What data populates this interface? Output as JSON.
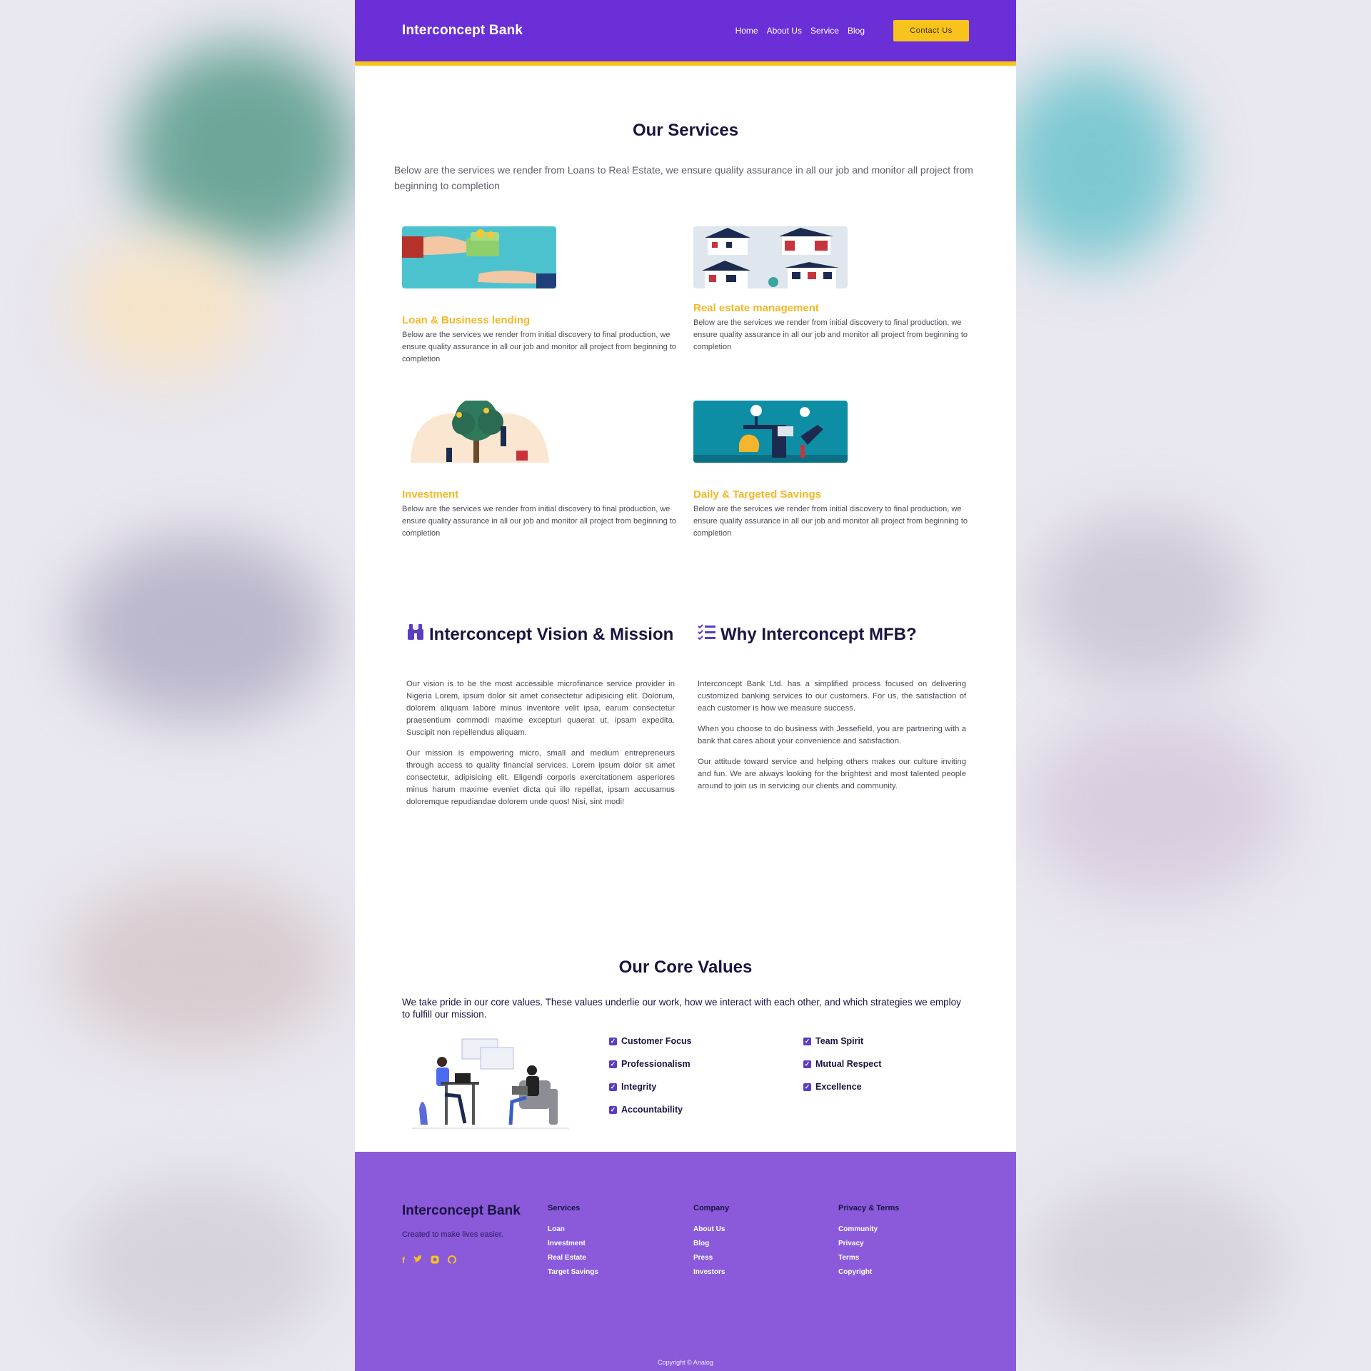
{
  "colors": {
    "brand_purple": "#6a2fd7",
    "accent_yellow": "#f7c31c",
    "footer_purple": "#8a5adb",
    "title_navy": "#1a1440"
  },
  "header": {
    "brand": "Interconcept Bank",
    "nav": [
      "Home",
      "About Us",
      "Service",
      "Blog"
    ],
    "contact_label": "Contact Us"
  },
  "services": {
    "title": "Our Services",
    "intro": "Below are the services we render from Loans to Real Estate, we ensure quality assurance in all our job and monitor all project from beginning to completion",
    "items": [
      {
        "title": "Loan & Business lending",
        "text": "Below are the services we render from initial discovery to final production, we ensure quality assurance in all our job and monitor all project from beginning to completion"
      },
      {
        "title": "Real estate management",
        "text": "Below are the services we render from initial discovery to final production, we ensure quality assurance in all our job and monitor all project from beginning to completion"
      },
      {
        "title": "Investment",
        "text": "Below are the services we render from initial discovery to final production, we ensure quality assurance in all our job and monitor all project from beginning to completion"
      },
      {
        "title": "Daily & Targeted Savings",
        "text": "Below are the services we render from initial discovery to final production, we ensure quality assurance in all our job and monitor all project from beginning to completion"
      }
    ]
  },
  "vision": {
    "title": "Interconcept Vision & Mission",
    "icon": "binoculars-icon",
    "paragraphs": [
      "Our vision is to be the most accessible microfinance service provider in Nigeria Lorem, ipsum dolor sit amet consectetur adipisicing elit. Dolorum, dolorem aliquam labore minus inventore velit ipsa, earum consectetur praesentium commodi maxime excepturi quaerat ut, ipsam expedita. Suscipit non repellendus aliquam.",
      "Our mission is empowering micro, small and medium entrepreneurs through access to quality financial services. Lorem ipsum dolor sit amet consectetur, adipisicing elit. Eligendi corporis exercitationem asperiores minus harum maxime eveniet dicta qui illo repellat, ipsam accusamus doloremque repudiandae dolorem unde quos! Nisi, sint modi!"
    ]
  },
  "why": {
    "title": "Why Interconcept MFB?",
    "icon": "checklist-icon",
    "paragraphs": [
      "Interconcept Bank Ltd. has a simplified process focused on delivering customized banking services to our customers. For us, the satisfaction of each customer is how we measure success.",
      "When you choose to do business with Jessefield, you are partnering with a bank that cares about your convenience and satisfaction.",
      "Our attitude toward service and helping others makes our culture inviting and fun. We are always looking for the brightest and most talented people around to join us in servicing our clients and community."
    ]
  },
  "core_values": {
    "title": "Our Core Values",
    "intro": "We take pride in our core values. These values underlie our work, how we interact with each other, and which strategies we employ to fulfill our mission.",
    "left": [
      "Customer Focus",
      "Professionalism",
      "Integrity",
      "Accountability"
    ],
    "right": [
      "Team Spirit",
      "Mutual Respect",
      "Excellence"
    ]
  },
  "footer": {
    "brand": "Interconcept Bank",
    "tagline": "Created to make lives easier.",
    "social": [
      "facebook-icon",
      "twitter-icon",
      "instagram-icon",
      "github-icon"
    ],
    "columns": [
      {
        "heading": "Services",
        "links": [
          "Loan",
          "Investment",
          "Real Estate",
          "Target Savings"
        ]
      },
      {
        "heading": "Company",
        "links": [
          "About Us",
          "Blog",
          "Press",
          "Investors"
        ]
      },
      {
        "heading": "Privacy & Terms",
        "links": [
          "Community",
          "Privacy",
          "Terms",
          "Copyright"
        ]
      }
    ],
    "copyright": "Copyright © Analog"
  }
}
